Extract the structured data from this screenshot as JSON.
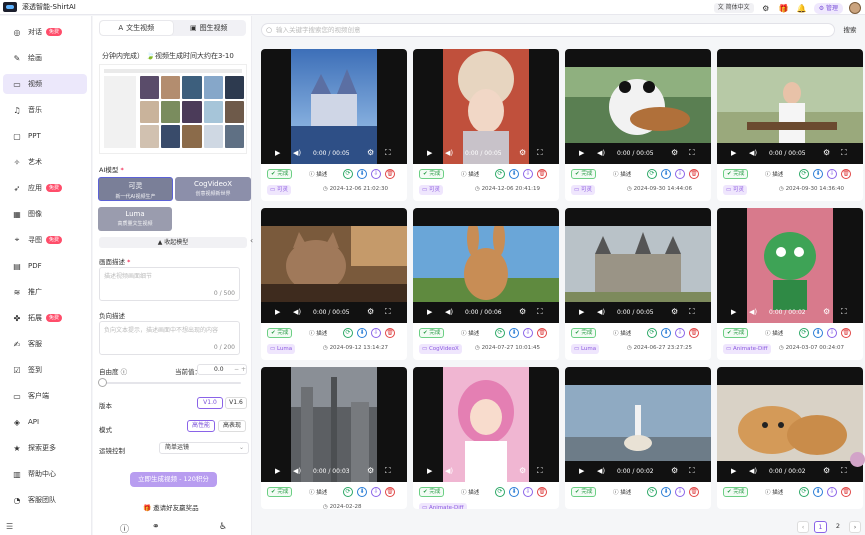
{
  "app": {
    "title": "滚透智能-ShirtAI"
  },
  "topbar": {
    "language": "简体中文",
    "admin": "管理",
    "icons": [
      "settings-icon",
      "gift-icon",
      "bell-icon"
    ]
  },
  "nav": {
    "items": [
      {
        "label": "对话",
        "icon": "chat-icon",
        "badge": "免费"
      },
      {
        "label": "绘画",
        "icon": "brush-icon"
      },
      {
        "label": "视频",
        "icon": "video-icon",
        "active": true
      },
      {
        "label": "音乐",
        "icon": "music-icon"
      },
      {
        "label": "PPT",
        "icon": "ppt-icon"
      },
      {
        "label": "艺术",
        "icon": "palette-icon"
      },
      {
        "label": "应用",
        "icon": "rocket-icon",
        "badge": "免费"
      },
      {
        "label": "图像",
        "icon": "image-icon"
      },
      {
        "label": "寻图",
        "icon": "location-icon",
        "badge": "免费"
      },
      {
        "label": "PDF",
        "icon": "pdf-icon"
      },
      {
        "label": "推广",
        "icon": "wifi-icon"
      },
      {
        "label": "拓展",
        "icon": "puzzle-icon",
        "badge": "免费"
      },
      {
        "label": "客服",
        "icon": "edit-icon"
      },
      {
        "label": "签到",
        "icon": "checkin-icon"
      },
      {
        "label": "客户端",
        "icon": "monitor-icon"
      },
      {
        "label": "API",
        "icon": "api-icon"
      },
      {
        "label": "探索更多",
        "icon": "star-icon"
      },
      {
        "label": "帮助中心",
        "icon": "document-icon"
      },
      {
        "label": "客服团队",
        "icon": "headset-icon"
      }
    ]
  },
  "panel": {
    "tabs": [
      "文生视频",
      "图生视频"
    ],
    "notice": "分钟内完成）  🍃视频生成时间大约在3-10",
    "ai_model_label": "AI模型",
    "models": [
      {
        "name": "可灵",
        "desc": "新一代AI视频生产",
        "selected": true
      },
      {
        "name": "CogVideoX",
        "desc": "创意视频新世界"
      },
      {
        "name": "Luma",
        "desc": "高质量文生视频"
      }
    ],
    "collapse_label": "收起模型",
    "prompt_label": "画面描述",
    "prompt_placeholder": "描述视频画面细节",
    "prompt_count": "0 / 500",
    "negative_label": "负向描述",
    "negative_placeholder": "负向文本提示，描述画面中不想出现的内容",
    "negative_count": "0 / 200",
    "freedom_label": "自由度",
    "current_value_label": "当前值：",
    "current_value": "0.0",
    "freedom_value": 0.0,
    "version_label": "版本",
    "versions": [
      "V1.0",
      "V1.6"
    ],
    "mode_label": "模式",
    "modes": [
      "高性能",
      "高表现"
    ],
    "camera_label": "运镜控制",
    "camera_value": "简单运镜",
    "generate_button": "立即生成视频 - 120积分",
    "invite": "邀请好友赢奖品"
  },
  "main": {
    "search_placeholder": "输入关键字搜索您的视频创意",
    "search_button": "搜索",
    "status_done": "完成",
    "desc_label": "描述",
    "videos": [
      {
        "time": "0:00 / 00:05",
        "model": "可灵",
        "date": "2024-12-06 21:02:30"
      },
      {
        "time": "0:00 / 00:05",
        "model": "可灵",
        "date": "2024-12-06 20:41:19"
      },
      {
        "time": "0:00 / 00:05",
        "model": "可灵",
        "date": "2024-09-30 14:44:06"
      },
      {
        "time": "0:00 / 00:05",
        "model": "可灵",
        "date": "2024-09-30 14:36:40"
      },
      {
        "time": "0:00 / 00:05",
        "model": "Luma",
        "date": "2024-09-12 13:14:27"
      },
      {
        "time": "0:00 / 00:06",
        "model": "CogVideoX",
        "date": "2024-07-27 10:01:45"
      },
      {
        "time": "0:00 / 00:05",
        "model": "Luma",
        "date": "2024-06-27 23:27:25"
      },
      {
        "time": "0:00 / 00:02",
        "model": "Animate-Diff",
        "date": "2024-03-07 00:24:07"
      },
      {
        "time": "0:00 / 00:03",
        "model": "",
        "date": "2024-02-28"
      },
      {
        "time": "0:00 / 00:02",
        "model": "Animate-Diff",
        "date": ""
      },
      {
        "time": "0:00 / 00:02",
        "model": "",
        "date": ""
      },
      {
        "time": "0:00 / 00:02",
        "model": "",
        "date": ""
      }
    ]
  },
  "pagination": {
    "pages": [
      "1",
      "2"
    ],
    "current": "1"
  }
}
